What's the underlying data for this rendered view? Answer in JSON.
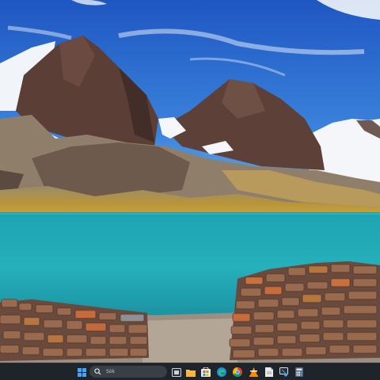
{
  "desktop": {
    "wallpaper": "mountain-lake-landscape"
  },
  "taskbar": {
    "search": {
      "placeholder": "Sök"
    },
    "icons": [
      "start-icon",
      "task-view-icon",
      "file-explorer-icon",
      "store-icon",
      "edge-browser-icon",
      "chrome-browser-icon",
      "vlc-media-player-icon",
      "document-icon",
      "snipping-tool-icon",
      "calculator-icon"
    ]
  },
  "colors": {
    "sky": "#2f6fd0",
    "lake": "#23a6b4",
    "taskbar": "#1f232a",
    "accent": "#3ea6ff"
  }
}
